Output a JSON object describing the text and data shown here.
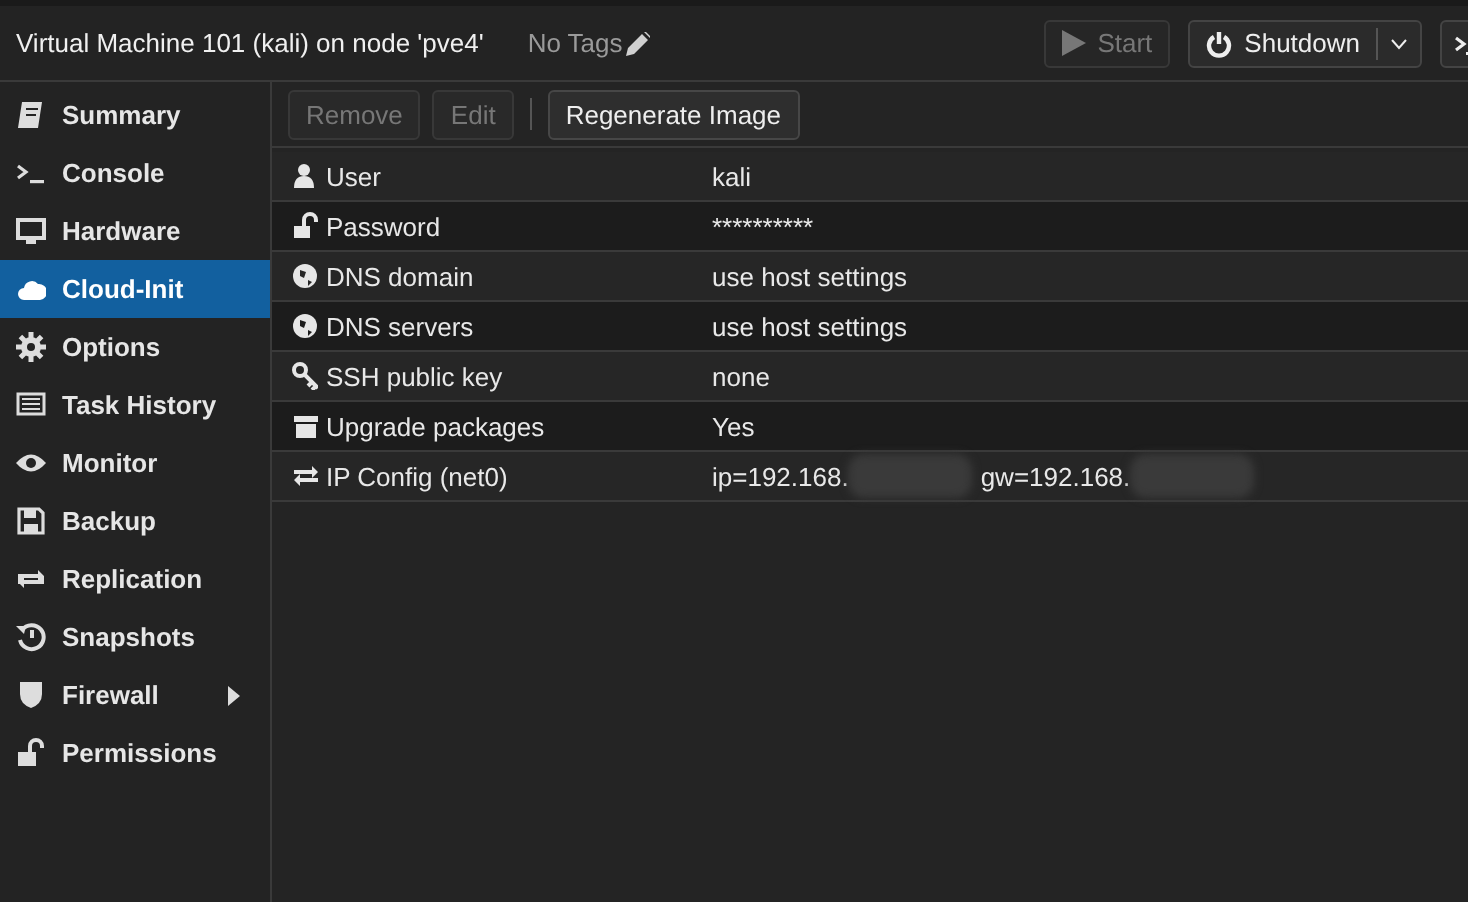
{
  "header": {
    "title": "Virtual Machine 101 (kali) on node 'pve4'",
    "tags": "No Tags",
    "buttons": [
      {
        "label": "Start",
        "kind": "start",
        "disabled": true
      },
      {
        "label": "Shutdown",
        "kind": "split",
        "disabled": false
      },
      {
        "kind": "console"
      }
    ]
  },
  "sidebar": {
    "items": [
      {
        "label": "Summary",
        "selected": false
      },
      {
        "label": "Console",
        "selected": false
      },
      {
        "label": "Hardware",
        "selected": false
      },
      {
        "label": "Cloud-Init",
        "selected": true
      },
      {
        "label": "Options",
        "selected": false
      },
      {
        "label": "Task History",
        "selected": false
      },
      {
        "label": "Monitor",
        "selected": false
      },
      {
        "label": "Backup",
        "selected": false
      },
      {
        "label": "Replication",
        "selected": false
      },
      {
        "label": "Snapshots",
        "selected": false
      },
      {
        "label": "Firewall",
        "selected": false,
        "has_submenu": true
      },
      {
        "label": "Permissions",
        "selected": false
      }
    ]
  },
  "toolbar": [
    {
      "label": "Remove",
      "disabled": true
    },
    {
      "label": "Edit",
      "disabled": true
    },
    {
      "label": "Regenerate Image",
      "disabled": false
    }
  ],
  "table": {
    "rows": [
      {
        "label": "User",
        "values": [
          "kali"
        ]
      },
      {
        "label": "Password",
        "values": [
          "**********"
        ]
      },
      {
        "label": "DNS domain",
        "values": [
          "use host settings"
        ]
      },
      {
        "label": "DNS servers",
        "values": [
          "use host settings"
        ]
      },
      {
        "label": "SSH public key",
        "values": [
          "none"
        ]
      },
      {
        "label": "Upgrade packages",
        "values": [
          "Yes"
        ]
      },
      {
        "label": "IP Config (net0)",
        "values": [
          "ip=192.168.",
          "gw=192.168."
        ],
        "redacted": true
      }
    ]
  }
}
